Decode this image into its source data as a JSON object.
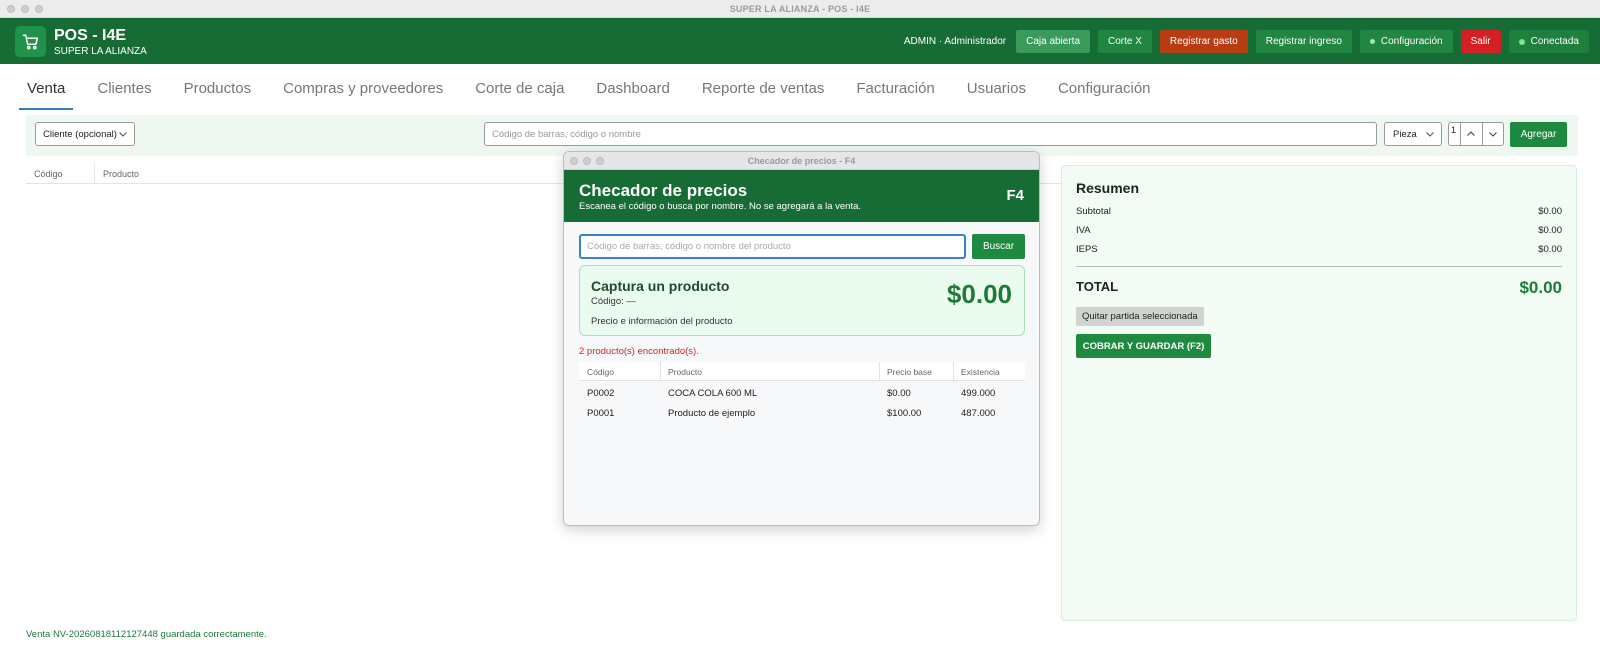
{
  "window": {
    "title": "SUPER LA ALIANZA - POS - I4E"
  },
  "header": {
    "brand_title": "POS - I4E",
    "brand_sub": "SUPER LA ALIANZA",
    "user": "ADMIN · Administrador",
    "buttons": {
      "caja": "Caja abierta",
      "corte_x": "Corte X",
      "gasto": "Registrar gasto",
      "ingreso": "Registrar ingreso",
      "config": "Configuración",
      "salir": "Salir",
      "conn": "Conectada"
    }
  },
  "tabs": [
    "Venta",
    "Clientes",
    "Productos",
    "Compras y proveedores",
    "Corte de caja",
    "Dashboard",
    "Reporte de ventas",
    "Facturación",
    "Usuarios",
    "Configuración"
  ],
  "toolbar": {
    "client_select": "Cliente (opcional)",
    "search_placeholder": "Código de barras, código o nombre",
    "unit_select": "Pieza",
    "quantity": "1",
    "add_button": "Agregar"
  },
  "cart_table": {
    "col_code": "Código",
    "col_product": "Producto"
  },
  "summary": {
    "title": "Resumen",
    "rows": [
      {
        "label": "Subtotal",
        "value": "$0.00"
      },
      {
        "label": "IVA",
        "value": "$0.00"
      },
      {
        "label": "IEPS",
        "value": "$0.00"
      }
    ],
    "total_label": "TOTAL",
    "total_value": "$0.00",
    "remove_button": "Quitar partida seleccionada",
    "pay_button": "COBRAR Y GUARDAR (F2)"
  },
  "status_message": "Venta NV-20260818112127448 guardada correctamente.",
  "price_checker": {
    "window_title": "Checador de precios - F4",
    "title": "Checador de precios",
    "subtitle": "Escanea el código o busca por nombre. No se agregará a la venta.",
    "shortcut": "F4",
    "search_placeholder": "Código de barras, código o nombre del producto",
    "search_button": "Buscar",
    "card_title": "Captura un producto",
    "card_code": "Código: —",
    "card_info": "Precio e información del producto",
    "card_price": "$0.00",
    "found_text": "2 producto(s) encontrado(s).",
    "columns": {
      "code": "Código",
      "product": "Producto",
      "price": "Precio base",
      "stock": "Existencia"
    },
    "rows": [
      {
        "code": "P0002",
        "product": "COCA COLA 600 ML",
        "price": "$0.00",
        "stock": "499.000"
      },
      {
        "code": "P0001",
        "product": "Producto de ejemplo",
        "price": "$100.00",
        "stock": "487.000"
      }
    ]
  }
}
